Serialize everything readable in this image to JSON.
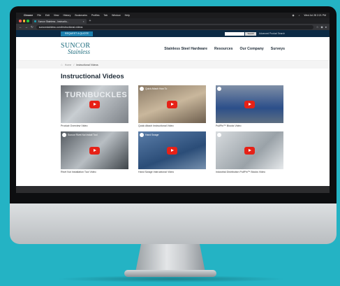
{
  "colors": {
    "background": "#24b3c4",
    "topbar": "#0c2a44",
    "quote_button": "#1a7fae",
    "brand_teal": "#1b6b7d",
    "play_red": "#e62117"
  },
  "mac_menu": {
    "app": "Chrome",
    "items": [
      "File",
      "Edit",
      "View",
      "History",
      "Bookmarks",
      "Profiles",
      "Tab",
      "Window",
      "Help"
    ],
    "clock": "Wed Jul 28  2:21 PM"
  },
  "browser": {
    "tab_title": "Suncor Stainless - Instructio...",
    "url": "suncorstainless.com/instructional-videos"
  },
  "topbar": {
    "quote_label": "REQUEST A QUOTE",
    "search_button": "Search",
    "advanced_search": "Advanced Product Search"
  },
  "logo": {
    "line1": "SUNCOR",
    "line2": "Stainless"
  },
  "nav": [
    {
      "label": "Stainless Steel Hardware"
    },
    {
      "label": "Resources"
    },
    {
      "label": "Our Company"
    },
    {
      "label": "Surveys"
    }
  ],
  "breadcrumb": {
    "home": "Home",
    "current": "Instructional Videos"
  },
  "page_title": "Instructional Videos",
  "videos": [
    {
      "caption": "Product Overview Video",
      "thumb_title": "",
      "thumb_text": "TURNBUCKLES"
    },
    {
      "caption": "Quick Attach Instructional Video",
      "thumb_title": "Quick Attach How To",
      "thumb_text": ""
    },
    {
      "caption": "PullPin™ Blocks Video",
      "thumb_title": "",
      "thumb_text": ""
    },
    {
      "caption": "Rivet Nut Installation Tool Video",
      "thumb_title": "Suncor Rivet Nut Install Tool",
      "thumb_text": ""
    },
    {
      "caption": "Hand Swage Instructional Video",
      "thumb_title": "Hand Swage",
      "thumb_text": ""
    },
    {
      "caption": "Industrial Distribution PullPin™ Blocks Video",
      "thumb_title": "",
      "thumb_text": ""
    }
  ]
}
